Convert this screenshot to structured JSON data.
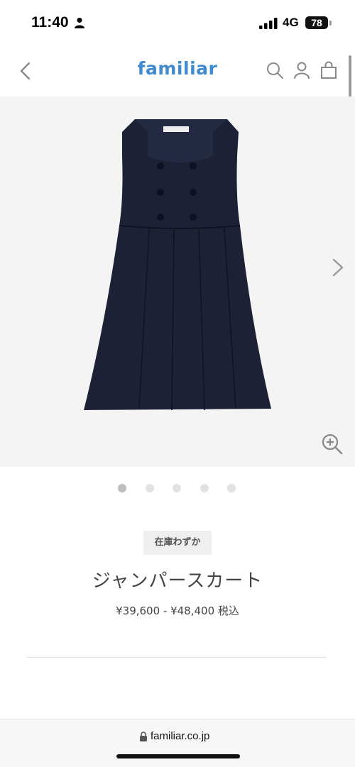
{
  "status_bar": {
    "time": "11:40",
    "network": "4G",
    "battery": "78"
  },
  "header": {
    "logo": "familiar"
  },
  "gallery": {
    "slide_count": 5,
    "active_slide": 1
  },
  "product": {
    "stock_badge": "在庫わずか",
    "title": "ジャンパースカート",
    "price": "¥39,600 - ¥48,400 税込"
  },
  "browser": {
    "url": "familiar.co.jp"
  },
  "icons": {
    "person": "person-icon",
    "signal": "signal-icon",
    "back": "chevron-left-icon",
    "search": "search-icon",
    "account": "account-icon",
    "cart": "cart-icon",
    "next": "chevron-right-icon",
    "zoom": "zoom-in-icon",
    "lock": "lock-icon"
  },
  "colors": {
    "brand": "#3f8bd1",
    "garment": "#1c2136"
  }
}
